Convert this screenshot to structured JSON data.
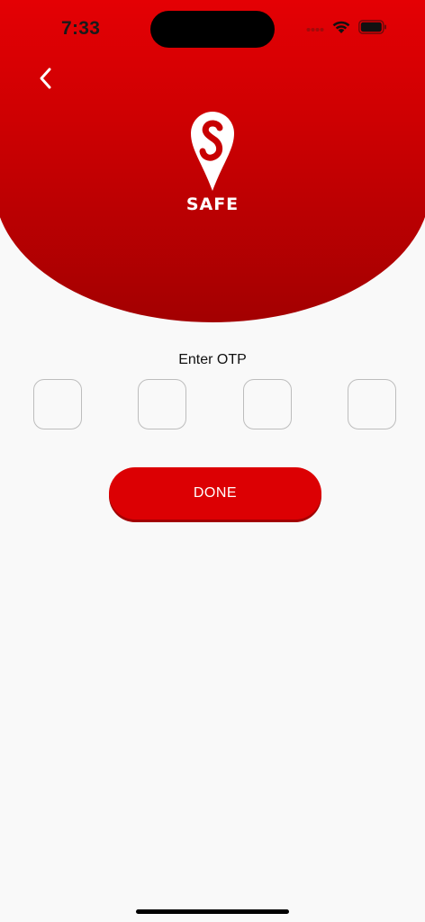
{
  "status_bar": {
    "time": "7:33",
    "wifi_icon": "wifi-icon",
    "battery_icon": "battery-icon",
    "signal_icon": "cellular-signal-icon"
  },
  "header": {
    "back_icon": "chevron-left-icon",
    "logo_text": "SAFE",
    "gradient_top": "#e40004",
    "gradient_bottom": "#a30001"
  },
  "otp": {
    "label": "Enter OTP",
    "digits": [
      "",
      "",
      "",
      ""
    ],
    "box_border": "#bdbdbd"
  },
  "actions": {
    "done_label": "DONE",
    "done_color": "#dc0003"
  }
}
